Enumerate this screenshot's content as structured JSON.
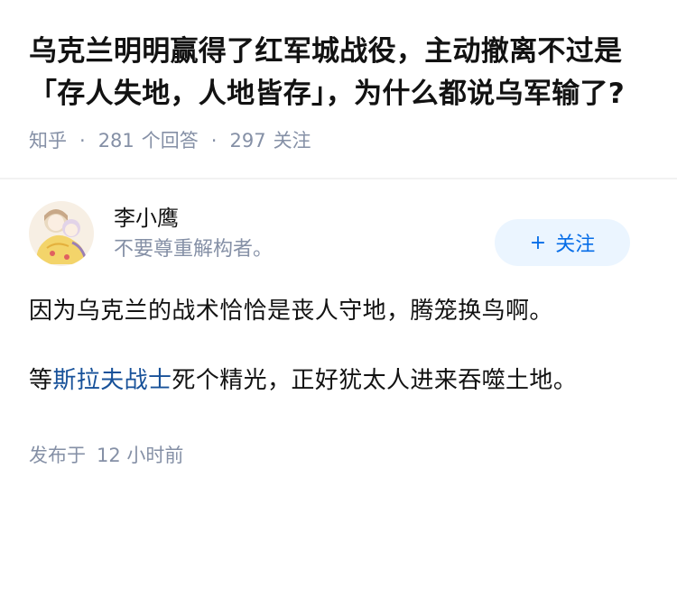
{
  "question": {
    "title": "乌克兰明明赢得了红军城战役，主动撤离不过是「存人失地，人地皆存」，为什么都说乌军输了?",
    "source": "知乎",
    "answers_count": "281",
    "answers_label": "个回答",
    "followers_count": "297",
    "followers_label": "关注"
  },
  "answer": {
    "author_name": "李小鹰",
    "author_bio": "不要尊重解构者。",
    "follow_label": "关注",
    "paragraph1": "因为乌克兰的战术恰恰是丧人守地，腾笼换鸟啊。",
    "p2_before": "等",
    "p2_link": "斯拉夫战士",
    "p2_after": "死个精光，正好犹太人进来吞噬土地。",
    "publish_label": "发布于",
    "publish_time": "12 小时前"
  },
  "colors": {
    "accent": "#056de8",
    "link": "#175199",
    "meta": "#8590a6",
    "follow_bg": "#ebf5ff"
  },
  "icons": {
    "avatar": "anime-avatar",
    "follow": "plus-icon"
  }
}
